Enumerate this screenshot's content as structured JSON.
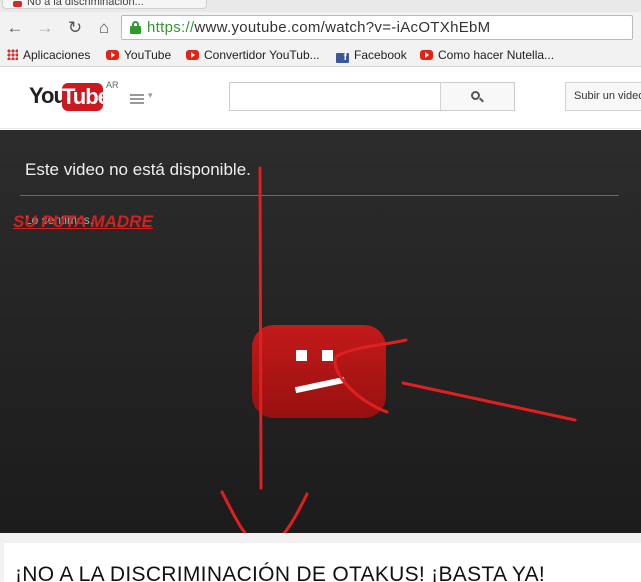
{
  "browser": {
    "tab_title": "No a la discriminación...",
    "nav": {
      "back_glyph": "←",
      "forward_glyph": "→",
      "reload_glyph": "↻",
      "home_glyph": "⌂"
    },
    "url_scheme": "https://",
    "url_rest": "www.youtube.com/watch?v=-iAcOTXhEbM",
    "bookmarks": [
      {
        "label": "Aplicaciones",
        "icon": "apps-icon"
      },
      {
        "label": "YouTube",
        "icon": "youtube-icon"
      },
      {
        "label": "Convertidor YouTub...",
        "icon": "youtube-icon"
      },
      {
        "label": "Facebook",
        "icon": "facebook-icon"
      },
      {
        "label": "Como hacer Nutella...",
        "icon": "youtube-icon"
      }
    ]
  },
  "youtube": {
    "logo_you": "You",
    "logo_tube": "Tube",
    "logo_country": "AR",
    "upload_label": "Subir un video"
  },
  "player": {
    "message": "Este video no está disponible.",
    "sub_message": "Lo sentimos.",
    "graffiti": "SU PUTA MADRE"
  },
  "video": {
    "title": "¡NO A LA DISCRIMINACIÓN DE OTAKUS! ¡BASTA YA!"
  },
  "colors": {
    "youtube_red": "#cc181e",
    "doodle_red": "#e02020",
    "player_bg": "#242424",
    "secure_green": "#2e9b2e"
  }
}
